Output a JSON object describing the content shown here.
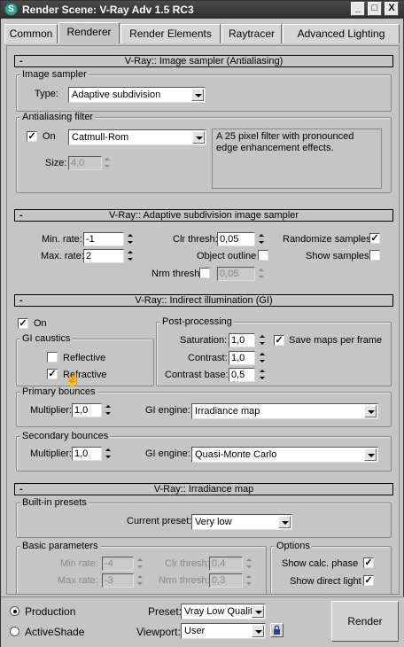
{
  "window": {
    "title": "Render Scene: V-Ray Adv 1.5 RC3",
    "icon": "3ds-max-app-icon",
    "controls": [
      "_",
      "□",
      "X"
    ]
  },
  "tabs": [
    {
      "label": "Common",
      "active": false
    },
    {
      "label": "Renderer",
      "active": true
    },
    {
      "label": "Render Elements",
      "active": false
    },
    {
      "label": "Raytracer",
      "active": false
    },
    {
      "label": "Advanced Lighting",
      "active": false
    }
  ],
  "image_sampler": {
    "header": "V-Ray:: Image sampler (Antialiasing)",
    "group_label": "Image sampler",
    "type_label": "Type:",
    "type_value": "Adaptive subdivision",
    "aa_group_label": "Antialiasing filter",
    "on_label": "On",
    "on_checked": true,
    "filter_value": "Catmull-Rom",
    "filter_description": "A 25 pixel filter with pronounced edge enhancement effects.",
    "size_label": "Size:",
    "size_value": "4,0"
  },
  "adaptive": {
    "header": "V-Ray:: Adaptive subdivision image sampler",
    "min_rate_label": "Min. rate:",
    "min_rate_value": "-1",
    "max_rate_label": "Max. rate:",
    "max_rate_value": "2",
    "clr_thresh_label": "Clr thresh:",
    "clr_thresh_value": "0,05",
    "object_outline_label": "Object outline",
    "nrm_thresh_label": "Nrm thresh:",
    "nrm_thresh_value": "0,05",
    "randomize_label": "Randomize samples",
    "randomize_checked": true,
    "show_samples_label": "Show samples",
    "show_samples_checked": false
  },
  "gi": {
    "header": "V-Ray:: Indirect illumination (GI)",
    "on_label": "On",
    "on_checked": true,
    "caustics_label": "GI caustics",
    "reflective_label": "Reflective",
    "reflective_checked": false,
    "refractive_label": "Refractive",
    "refractive_checked": true,
    "post_label": "Post-processing",
    "saturation_label": "Saturation:",
    "saturation_value": "1,0",
    "contrast_label": "Contrast:",
    "contrast_value": "1,0",
    "contrast_base_label": "Contrast base:",
    "contrast_base_value": "0,5",
    "save_maps_label": "Save maps per frame",
    "save_maps_checked": true,
    "primary_label": "Primary bounces",
    "primary_multiplier_label": "Multiplier:",
    "primary_multiplier_value": "1,0",
    "primary_engine_label": "GI engine:",
    "primary_engine_value": "Irradiance map",
    "secondary_label": "Secondary bounces",
    "secondary_multiplier_label": "Multiplier:",
    "secondary_multiplier_value": "1,0",
    "secondary_engine_label": "GI engine:",
    "secondary_engine_value": "Quasi-Monte Carlo"
  },
  "irradiance": {
    "header": "V-Ray:: Irradiance map",
    "presets_label": "Built-in presets",
    "current_preset_label": "Current preset:",
    "current_preset_value": "Very low",
    "basic_label": "Basic parameters",
    "min_rate_label": "Min rate:",
    "min_rate_value": "-4",
    "max_rate_label": "Max rate:",
    "max_rate_value": "-3",
    "clr_thresh_label": "Clr thresh:",
    "clr_thresh_value": "0,4",
    "nrm_thresh_label": "Nrm thresh:",
    "nrm_thresh_value": "0,3",
    "options_label": "Options",
    "show_calc_label": "Show calc. phase",
    "show_calc_checked": true,
    "show_direct_label": "Show direct light",
    "show_direct_checked": true
  },
  "bottom": {
    "production_label": "Production",
    "activeshade_label": "ActiveShade",
    "preset_label": "Preset:",
    "preset_value": "Vray Low Qualit",
    "viewport_label": "Viewport:",
    "viewport_value": "User",
    "render_label": "Render"
  }
}
